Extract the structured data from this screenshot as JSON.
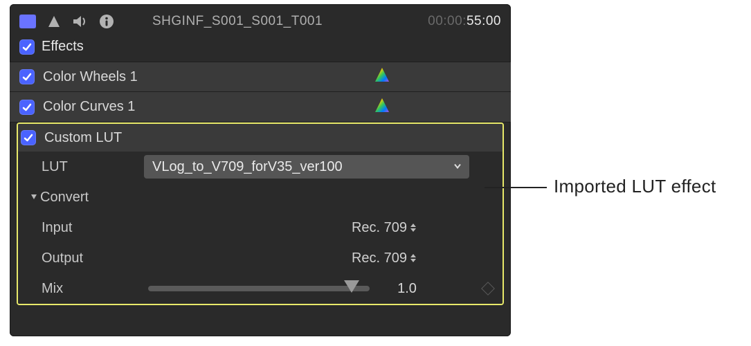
{
  "header": {
    "clip_title": "SHGINF_S001_S001_T001",
    "timecode_dim": "00:00:",
    "timecode_bright": "55:00"
  },
  "effects_section_label": "Effects",
  "effects": [
    {
      "label": "Color Wheels 1",
      "checked": true,
      "has_color_badge": true
    },
    {
      "label": "Color Curves 1",
      "checked": true,
      "has_color_badge": true
    }
  ],
  "custom_lut": {
    "row_label": "Custom LUT",
    "checked": true,
    "lut_param_label": "LUT",
    "lut_selected": "VLog_to_V709_forV35_ver100",
    "convert_label": "Convert",
    "input_label": "Input",
    "input_value": "Rec. 709",
    "output_label": "Output",
    "output_value": "Rec. 709",
    "mix_label": "Mix",
    "mix_value": "1.0",
    "mix_position_percent": 92
  },
  "callout": {
    "text": "Imported LUT effect"
  }
}
